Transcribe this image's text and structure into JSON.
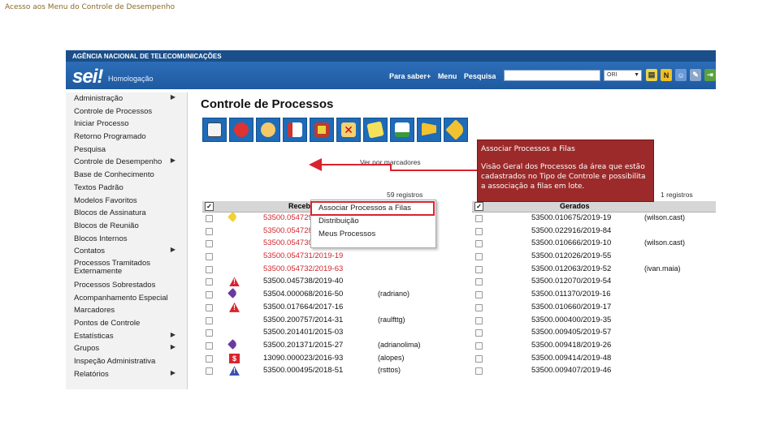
{
  "slide": {
    "title": "Acesso aos Menu do Controle de Desempenho"
  },
  "app": {
    "agency": "AGÊNCIA NACIONAL DE TELECOMUNICAÇÕES",
    "logo": "sei!",
    "environment": "Homologação",
    "nav": {
      "para_saber": "Para saber+",
      "menu": "Menu",
      "pesquisa": "Pesquisa"
    },
    "unit_select": "ORI",
    "header_icons": [
      "notepad-icon",
      "n-icon",
      "user-icon",
      "tools-icon",
      "exit-icon"
    ]
  },
  "sidebar": {
    "items": [
      {
        "label": "Administração",
        "submenu": true
      },
      {
        "label": "Controle de Processos",
        "submenu": false
      },
      {
        "label": "Iniciar Processo",
        "submenu": false
      },
      {
        "label": "Retorno Programado",
        "submenu": false
      },
      {
        "label": "Pesquisa",
        "submenu": false
      },
      {
        "label": "Controle de Desempenho",
        "submenu": true
      },
      {
        "label": "Base de Conhecimento",
        "submenu": false
      },
      {
        "label": "Textos Padrão",
        "submenu": false
      },
      {
        "label": "Modelos Favoritos",
        "submenu": false
      },
      {
        "label": "Blocos de Assinatura",
        "submenu": false
      },
      {
        "label": "Blocos de Reunião",
        "submenu": false
      },
      {
        "label": "Blocos Internos",
        "submenu": false
      },
      {
        "label": "Contatos",
        "submenu": true
      },
      {
        "label": "Processos Tramitados Externamente",
        "submenu": false
      },
      {
        "label": "Processos Sobrestados",
        "submenu": false
      },
      {
        "label": "Acompanhamento Especial",
        "submenu": false
      },
      {
        "label": "Marcadores",
        "submenu": false
      },
      {
        "label": "Pontos de Controle",
        "submenu": false
      },
      {
        "label": "Estatísticas",
        "submenu": true
      },
      {
        "label": "Grupos",
        "submenu": true
      },
      {
        "label": "Inspeção Administrativa",
        "submenu": false
      },
      {
        "label": "Relatórios",
        "submenu": true
      }
    ]
  },
  "main": {
    "title": "Controle de Processos",
    "toolbar": [
      "send-icon",
      "tools-icon",
      "assign-icon",
      "documents-icon",
      "sobrestar-icon",
      "cancel-icon",
      "notes-icon",
      "new-doc-icon",
      "flag-icon",
      "tag-icon"
    ],
    "markers_link": "Ver por marcadores",
    "count_left": "59 registros",
    "count_right": "1 registros"
  },
  "dropdown": {
    "items": [
      "Associar Processos a Filas",
      "Distribuição",
      "Meus Processos"
    ]
  },
  "callout": {
    "title": "Associar Processos a Filas",
    "body": "Visão Geral dos Processos da área que estão cadastrados no Tipo de Controle e possibilita a associação a filas em lote."
  },
  "table_received": {
    "header_check": "✓",
    "header": "Recebidos",
    "rows": [
      {
        "process": "53500.054729/2019-40",
        "red": true,
        "icon": "tag-yellow",
        "user": ""
      },
      {
        "process": "53500.054728/2019-03",
        "red": true,
        "icon": "",
        "user": ""
      },
      {
        "process": "53500.054730/2019-74",
        "red": true,
        "icon": "",
        "user": ""
      },
      {
        "process": "53500.054731/2019-19",
        "red": true,
        "icon": "",
        "user": ""
      },
      {
        "process": "53500.054732/2019-63",
        "red": true,
        "icon": "",
        "user": ""
      },
      {
        "process": "53500.045738/2019-40",
        "red": false,
        "icon": "alert",
        "user": ""
      },
      {
        "process": "53504.000068/2016-50",
        "red": false,
        "icon": "tag-purple",
        "user": "(radriano)"
      },
      {
        "process": "53500.017664/2017-16",
        "red": false,
        "icon": "alert",
        "user": ""
      },
      {
        "process": "53500.200757/2014-31",
        "red": false,
        "icon": "",
        "user": "(raulfttg)"
      },
      {
        "process": "53500.201401/2015-03",
        "red": false,
        "icon": "",
        "user": ""
      },
      {
        "process": "53500.201371/2015-27",
        "red": false,
        "icon": "tag-purple",
        "user": "(adrianolima)"
      },
      {
        "process": "13090.000023/2016-93",
        "red": false,
        "icon": "red-box",
        "user": "(alopes)"
      },
      {
        "process": "53500.000495/2018-51",
        "red": false,
        "icon": "blue-triangle",
        "user": "(rsttos)"
      }
    ]
  },
  "table_generated": {
    "header_check": "✓",
    "header": "Gerados",
    "rows": [
      {
        "process": "53500.010675/2019-19",
        "user": "(wilson.cast)"
      },
      {
        "process": "53500.022916/2019-84",
        "user": ""
      },
      {
        "process": "53500.010666/2019-10",
        "user": "(wilson.cast)"
      },
      {
        "process": "53500.012026/2019-55",
        "user": ""
      },
      {
        "process": "53500.012063/2019-52",
        "user": "(ivan.maia)"
      },
      {
        "process": "53500.012070/2019-54",
        "user": ""
      },
      {
        "process": "53500.011370/2019-16",
        "user": ""
      },
      {
        "process": "53500.010660/2019-17",
        "user": ""
      },
      {
        "process": "53500.000400/2019-35",
        "user": ""
      },
      {
        "process": "53500.009405/2019-57",
        "user": ""
      },
      {
        "process": "53500.009418/2019-26",
        "user": ""
      },
      {
        "process": "53500.009414/2019-48",
        "user": ""
      },
      {
        "process": "53500.009407/2019-46",
        "user": ""
      }
    ]
  },
  "colors": {
    "header_blue": "#1e5aa0",
    "callout": "#9c2a2a",
    "highlight": "#d9232e",
    "red_process": "#d0272e"
  }
}
